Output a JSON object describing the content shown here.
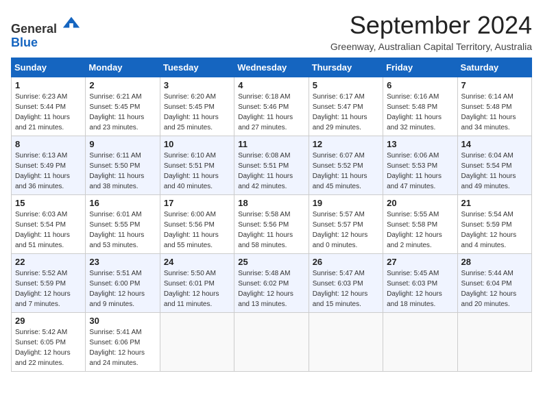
{
  "header": {
    "logo_line1": "General",
    "logo_line2": "Blue",
    "main_title": "September 2024",
    "subtitle": "Greenway, Australian Capital Territory, Australia"
  },
  "days_of_week": [
    "Sunday",
    "Monday",
    "Tuesday",
    "Wednesday",
    "Thursday",
    "Friday",
    "Saturday"
  ],
  "weeks": [
    [
      {
        "day": "1",
        "sunrise": "6:23 AM",
        "sunset": "5:44 PM",
        "daylight": "11 hours and 21 minutes."
      },
      {
        "day": "2",
        "sunrise": "6:21 AM",
        "sunset": "5:45 PM",
        "daylight": "11 hours and 23 minutes."
      },
      {
        "day": "3",
        "sunrise": "6:20 AM",
        "sunset": "5:45 PM",
        "daylight": "11 hours and 25 minutes."
      },
      {
        "day": "4",
        "sunrise": "6:18 AM",
        "sunset": "5:46 PM",
        "daylight": "11 hours and 27 minutes."
      },
      {
        "day": "5",
        "sunrise": "6:17 AM",
        "sunset": "5:47 PM",
        "daylight": "11 hours and 29 minutes."
      },
      {
        "day": "6",
        "sunrise": "6:16 AM",
        "sunset": "5:48 PM",
        "daylight": "11 hours and 32 minutes."
      },
      {
        "day": "7",
        "sunrise": "6:14 AM",
        "sunset": "5:48 PM",
        "daylight": "11 hours and 34 minutes."
      }
    ],
    [
      {
        "day": "8",
        "sunrise": "6:13 AM",
        "sunset": "5:49 PM",
        "daylight": "11 hours and 36 minutes."
      },
      {
        "day": "9",
        "sunrise": "6:11 AM",
        "sunset": "5:50 PM",
        "daylight": "11 hours and 38 minutes."
      },
      {
        "day": "10",
        "sunrise": "6:10 AM",
        "sunset": "5:51 PM",
        "daylight": "11 hours and 40 minutes."
      },
      {
        "day": "11",
        "sunrise": "6:08 AM",
        "sunset": "5:51 PM",
        "daylight": "11 hours and 42 minutes."
      },
      {
        "day": "12",
        "sunrise": "6:07 AM",
        "sunset": "5:52 PM",
        "daylight": "11 hours and 45 minutes."
      },
      {
        "day": "13",
        "sunrise": "6:06 AM",
        "sunset": "5:53 PM",
        "daylight": "11 hours and 47 minutes."
      },
      {
        "day": "14",
        "sunrise": "6:04 AM",
        "sunset": "5:54 PM",
        "daylight": "11 hours and 49 minutes."
      }
    ],
    [
      {
        "day": "15",
        "sunrise": "6:03 AM",
        "sunset": "5:54 PM",
        "daylight": "11 hours and 51 minutes."
      },
      {
        "day": "16",
        "sunrise": "6:01 AM",
        "sunset": "5:55 PM",
        "daylight": "11 hours and 53 minutes."
      },
      {
        "day": "17",
        "sunrise": "6:00 AM",
        "sunset": "5:56 PM",
        "daylight": "11 hours and 55 minutes."
      },
      {
        "day": "18",
        "sunrise": "5:58 AM",
        "sunset": "5:56 PM",
        "daylight": "11 hours and 58 minutes."
      },
      {
        "day": "19",
        "sunrise": "5:57 AM",
        "sunset": "5:57 PM",
        "daylight": "12 hours and 0 minutes."
      },
      {
        "day": "20",
        "sunrise": "5:55 AM",
        "sunset": "5:58 PM",
        "daylight": "12 hours and 2 minutes."
      },
      {
        "day": "21",
        "sunrise": "5:54 AM",
        "sunset": "5:59 PM",
        "daylight": "12 hours and 4 minutes."
      }
    ],
    [
      {
        "day": "22",
        "sunrise": "5:52 AM",
        "sunset": "5:59 PM",
        "daylight": "12 hours and 7 minutes."
      },
      {
        "day": "23",
        "sunrise": "5:51 AM",
        "sunset": "6:00 PM",
        "daylight": "12 hours and 9 minutes."
      },
      {
        "day": "24",
        "sunrise": "5:50 AM",
        "sunset": "6:01 PM",
        "daylight": "12 hours and 11 minutes."
      },
      {
        "day": "25",
        "sunrise": "5:48 AM",
        "sunset": "6:02 PM",
        "daylight": "12 hours and 13 minutes."
      },
      {
        "day": "26",
        "sunrise": "5:47 AM",
        "sunset": "6:03 PM",
        "daylight": "12 hours and 15 minutes."
      },
      {
        "day": "27",
        "sunrise": "5:45 AM",
        "sunset": "6:03 PM",
        "daylight": "12 hours and 18 minutes."
      },
      {
        "day": "28",
        "sunrise": "5:44 AM",
        "sunset": "6:04 PM",
        "daylight": "12 hours and 20 minutes."
      }
    ],
    [
      {
        "day": "29",
        "sunrise": "5:42 AM",
        "sunset": "6:05 PM",
        "daylight": "12 hours and 22 minutes."
      },
      {
        "day": "30",
        "sunrise": "5:41 AM",
        "sunset": "6:06 PM",
        "daylight": "12 hours and 24 minutes."
      },
      null,
      null,
      null,
      null,
      null
    ]
  ],
  "labels": {
    "sunrise": "Sunrise:",
    "sunset": "Sunset:",
    "daylight": "Daylight:"
  }
}
